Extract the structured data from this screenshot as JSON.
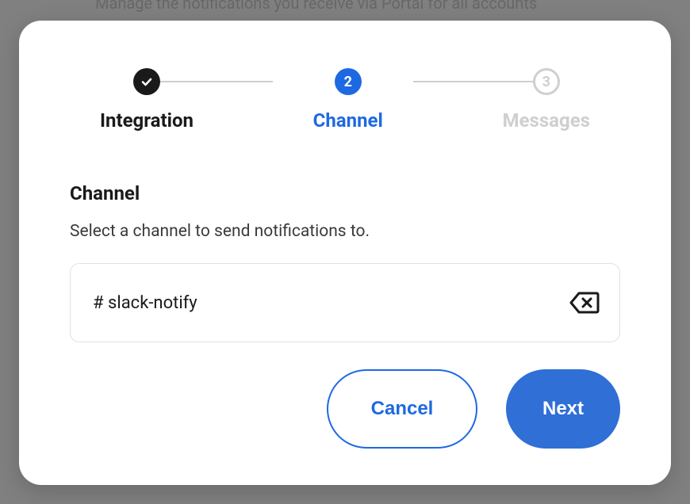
{
  "background": {
    "snippet": "Manage the notifications you receive via Portal for all accounts"
  },
  "stepper": {
    "steps": [
      {
        "num": "1",
        "label": "Integration",
        "state": "done"
      },
      {
        "num": "2",
        "label": "Channel",
        "state": "current"
      },
      {
        "num": "3",
        "label": "Messages",
        "state": "future"
      }
    ]
  },
  "section": {
    "title": "Channel",
    "description": "Select a channel to send notifications to."
  },
  "input": {
    "value": "# slack-notify"
  },
  "buttons": {
    "cancel": "Cancel",
    "next": "Next"
  }
}
